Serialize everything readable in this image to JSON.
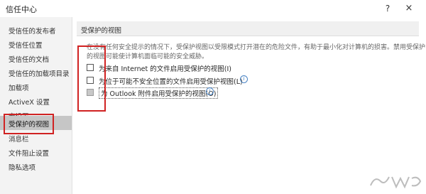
{
  "window": {
    "title": "信任中心",
    "help_label": "?",
    "close_label": "×"
  },
  "sidebar": {
    "items": [
      {
        "label": "受信任的发布者",
        "selected": false
      },
      {
        "label": "受信任位置",
        "selected": false
      },
      {
        "label": "受信任的文档",
        "selected": false
      },
      {
        "label": "受信任的加载项目录",
        "selected": false
      },
      {
        "label": "加载项",
        "selected": false
      },
      {
        "label": "ActiveX 设置",
        "selected": false
      },
      {
        "label": "宏设置",
        "selected": false
      },
      {
        "label": "受保护的视图",
        "selected": true
      },
      {
        "label": "消息栏",
        "selected": false
      },
      {
        "label": "文件阻止设置",
        "selected": false
      },
      {
        "label": "隐私选项",
        "selected": false
      }
    ]
  },
  "main": {
    "section_title": "受保护的视图",
    "description_line1": "在没有任何安全提示的情况下，受保护视图以受限模式打开潜在的危险文件，有助于最小化对计算机的损害。禁用受保护",
    "description_line2": "的视图可能使计算机面临可能的安全威胁。",
    "options": [
      {
        "label": "为来自 Internet 的文件启用受保护的视图(I)",
        "checked": false,
        "enabled": true,
        "info_icon": false
      },
      {
        "label": "为位于可能不安全位置的文件启用受保护视图(L)",
        "checked": false,
        "enabled": true,
        "info_icon": true
      },
      {
        "label": "为 Outlook 附件启用受保护的视图(O)",
        "checked": false,
        "enabled": false,
        "info_icon": true
      }
    ]
  },
  "annotations": {
    "highlight_color": "#d02222"
  }
}
